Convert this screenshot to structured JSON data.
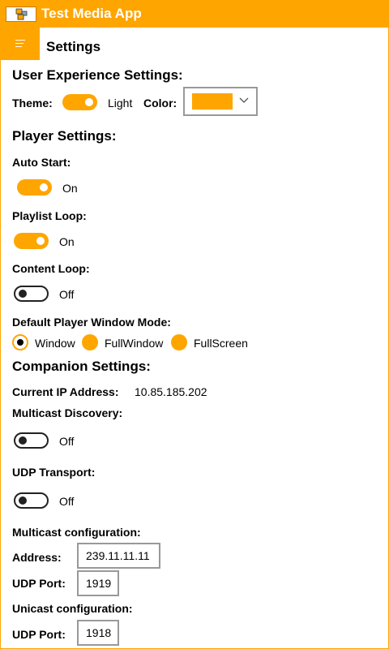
{
  "app": {
    "title": "Test Media App"
  },
  "page": {
    "title": "Settings"
  },
  "colors": {
    "accent": "#FFA500"
  },
  "ux": {
    "heading": "User Experience Settings:",
    "theme_label": "Theme:",
    "theme_value": "Light",
    "theme_on": true,
    "color_label": "Color:",
    "color_value": "#FFA500"
  },
  "player": {
    "heading": "Player Settings:",
    "auto_start_label": "Auto Start:",
    "auto_start_state": "On",
    "playlist_loop_label": "Playlist Loop:",
    "playlist_loop_state": "On",
    "content_loop_label": "Content Loop:",
    "content_loop_state": "Off",
    "window_mode_label": "Default Player Window Mode:",
    "window_modes": [
      "Window",
      "FullWindow",
      "FullScreen"
    ],
    "window_mode_selected": "Window"
  },
  "companion": {
    "heading": "Companion Settings:",
    "ip_label": "Current IP Address:",
    "ip_value": "10.85.185.202",
    "multicast_discovery_label": "Multicast Discovery:",
    "multicast_discovery_state": "Off",
    "udp_transport_label": "UDP Transport:",
    "udp_transport_state": "Off",
    "multicast_config_label": "Multicast configuration:",
    "multicast_address_label": "Address:",
    "multicast_address_value": "239.11.11.11",
    "multicast_port_label": "UDP Port:",
    "multicast_port_value": "1919",
    "unicast_config_label": "Unicast configuration:",
    "unicast_port_label": "UDP Port:",
    "unicast_port_value": "1918"
  },
  "icons": {
    "app": "app-logo-icon",
    "menu": "hamburger-menu-icon",
    "dropdown": "chevron-down-icon"
  }
}
